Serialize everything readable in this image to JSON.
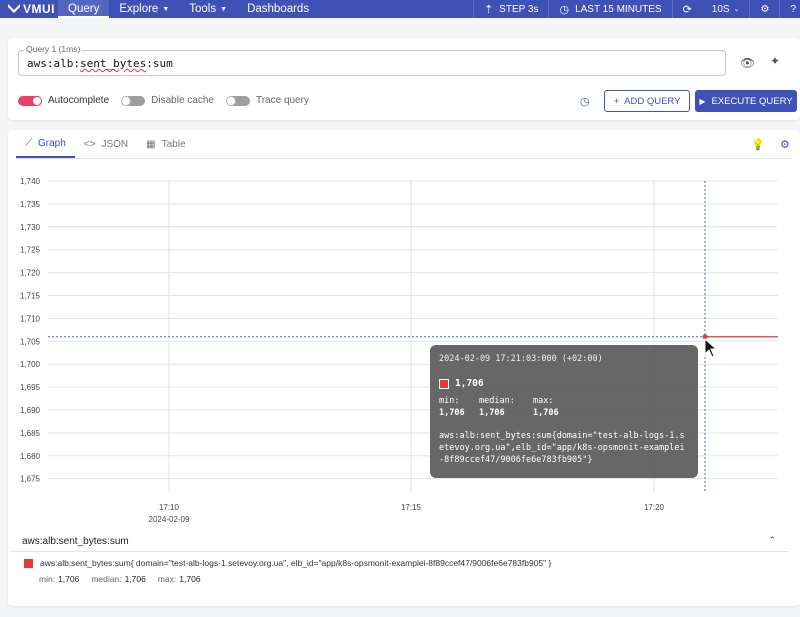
{
  "header": {
    "logo": "VMUI",
    "nav": [
      {
        "label": "Query"
      },
      {
        "label": "Explore"
      },
      {
        "label": "Tools"
      },
      {
        "label": "Dashboards"
      }
    ],
    "step_label": "STEP 3s",
    "time_range_label": "LAST 15 MINUTES",
    "refresh_label": "10S"
  },
  "query": {
    "label": "Query 1 (1ms)",
    "value_prefix": "aws:alb:",
    "value_underlined": "sent_bytes",
    "value_suffix": ":sum",
    "autocomplete_label": "Autocomplete",
    "disable_cache_label": "Disable cache",
    "trace_query_label": "Trace query",
    "add_query_label": "ADD QUERY",
    "execute_query_label": "EXECUTE QUERY"
  },
  "tabs": [
    {
      "label": "Graph"
    },
    {
      "label": "JSON"
    },
    {
      "label": "Table"
    }
  ],
  "chart_data": {
    "type": "line",
    "y_ticks": [
      "1,740",
      "1,735",
      "1,730",
      "1,725",
      "1,720",
      "1,715",
      "1,710",
      "1,705",
      "1,700",
      "1,695",
      "1,690",
      "1,685",
      "1,680",
      "1,675"
    ],
    "ylim": [
      1672,
      1742
    ],
    "x_ticks": [
      {
        "label": "17:10",
        "sublabel": "2024-02-09"
      },
      {
        "label": "17:15",
        "sublabel": ""
      },
      {
        "label": "17:20",
        "sublabel": ""
      }
    ],
    "series": [
      {
        "name": "aws:alb:sent_bytes:sum{domain=\"test-alb-logs-1.setevoy.org.ua\",elb_id=\"app/k8s-opsmonit-examplei-8f89ccef47/9006fe6e783fb905\"}",
        "color": "#e53935",
        "points": [
          [
            "17:21:03",
            1706
          ],
          [
            "17:22",
            1706
          ]
        ]
      }
    ],
    "hover_value": 1706
  },
  "tooltip": {
    "date": "2024-02-09 17:21:03:000 (+02:00)",
    "value": "1,706",
    "min_label": "min:",
    "median_label": "median:",
    "max_label": "max:",
    "min": "1,706",
    "median": "1,706",
    "max": "1,706",
    "series_label": "aws:alb:sent_bytes:sum{domain=\"test-alb-logs-1.setevoy.org.ua\",elb_id=\"app/k8s-opsmonit-examplei-8f89ccef47/9006fe6e783fb905\"}"
  },
  "legend": {
    "title": "aws:alb:sent_bytes:sum",
    "item_label": "aws:alb:sent_bytes:sum{ domain=\"test-alb-logs-1.setevoy.org.ua\", elb_id=\"app/k8s-opsmonit-examplei-8f89ccef47/9006fe6e783fb905\" }",
    "min_label": "min:",
    "min": "1,706",
    "median_label": "median:",
    "median": "1,706",
    "max_label": "max:",
    "max": "1,706"
  },
  "colors": {
    "primary": "#3f51b5",
    "series": "#e53935",
    "toggle_on": "#e6416b"
  }
}
